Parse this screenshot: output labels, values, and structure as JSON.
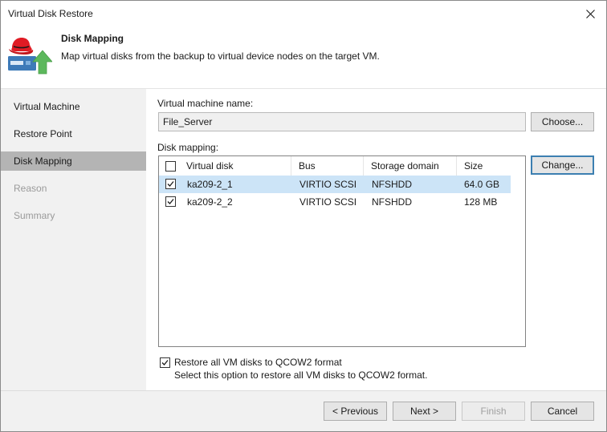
{
  "window": {
    "title": "Virtual Disk Restore"
  },
  "header": {
    "title": "Disk Mapping",
    "description": "Map virtual disks from the backup to virtual device nodes on the target VM.",
    "icon": "redhat-restore-icon"
  },
  "sidebar": {
    "items": [
      {
        "label": "Virtual Machine",
        "state": "normal"
      },
      {
        "label": "Restore Point",
        "state": "normal"
      },
      {
        "label": "Disk Mapping",
        "state": "active"
      },
      {
        "label": "Reason",
        "state": "disabled"
      },
      {
        "label": "Summary",
        "state": "disabled"
      }
    ]
  },
  "main": {
    "vm_name_label": "Virtual machine name:",
    "vm_name_value": "File_Server",
    "choose_label": "Choose...",
    "disk_mapping_label": "Disk mapping:",
    "change_label": "Change...",
    "columns": [
      "Virtual disk",
      "Bus",
      "Storage domain",
      "Size"
    ],
    "rows": [
      {
        "checked": true,
        "disk": "ka209-2_1",
        "bus": "VIRTIO SCSI",
        "storage": "NFSHDD",
        "size": "64.0 GB",
        "selected": true
      },
      {
        "checked": true,
        "disk": "ka209-2_2",
        "bus": "VIRTIO SCSI",
        "storage": "NFSHDD",
        "size": "128 MB",
        "selected": false
      }
    ],
    "qcow2_checked": true,
    "qcow2_label": "Restore all VM disks to QCOW2 format",
    "qcow2_hint": "Select this option to restore all VM disks to QCOW2 format."
  },
  "footer": {
    "previous": "< Previous",
    "next": "Next >",
    "finish": "Finish",
    "cancel": "Cancel"
  },
  "colors": {
    "selection": "#cce4f7",
    "active_nav": "#b4b4b4",
    "sidebar_bg": "#f1f1f1"
  }
}
